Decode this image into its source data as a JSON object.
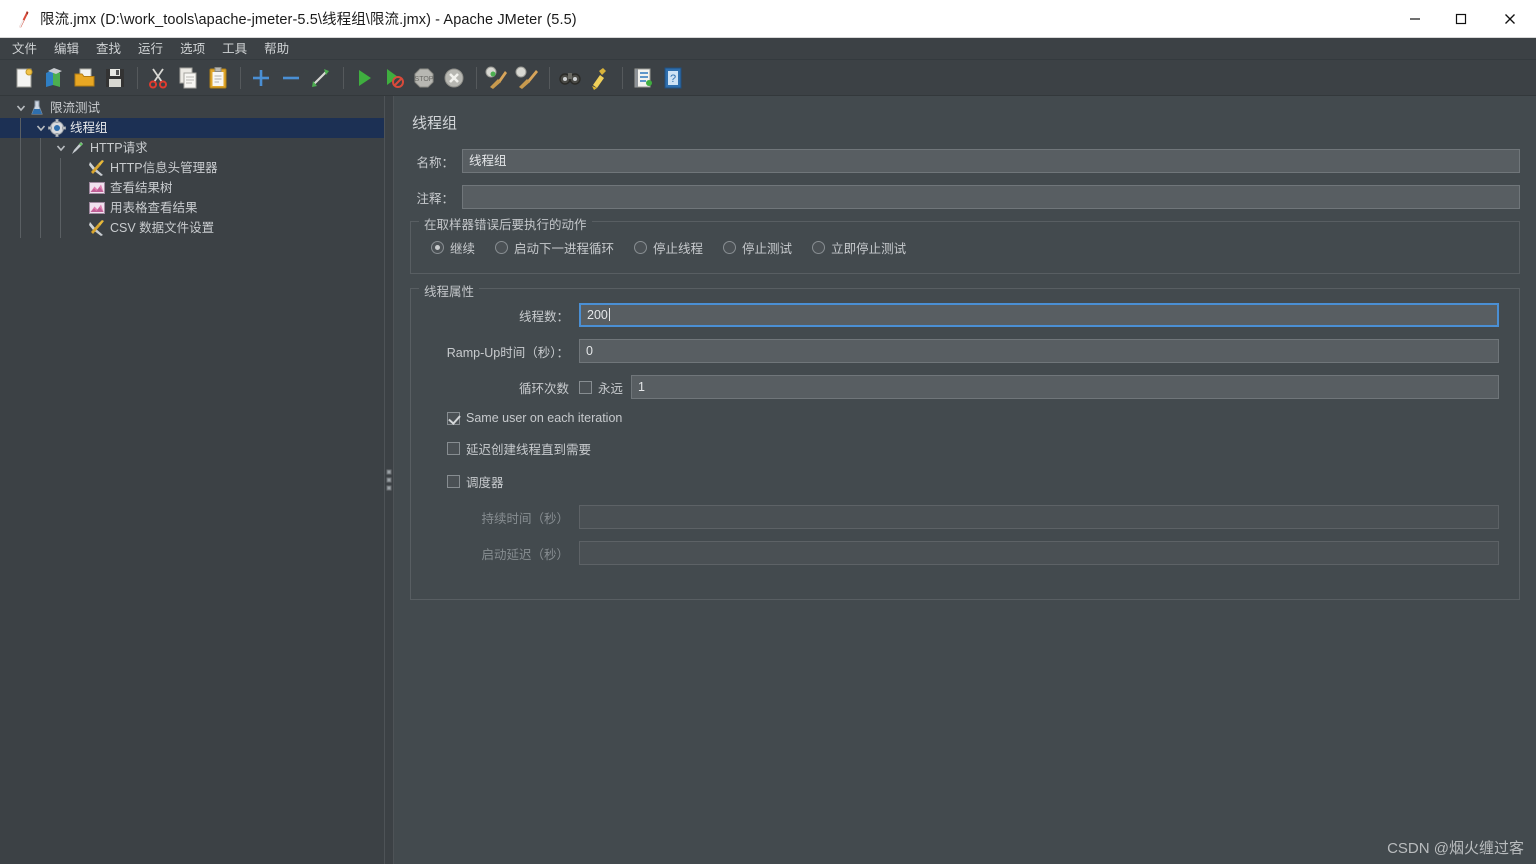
{
  "window": {
    "title": "限流.jmx (D:\\work_tools\\apache-jmeter-5.5\\线程组\\限流.jmx) - Apache JMeter (5.5)",
    "app_icon": "jmeter-feather-icon",
    "controls": {
      "minimize": "—",
      "maximize": "□",
      "close": "✕"
    }
  },
  "menubar": {
    "items": [
      {
        "label": "文件",
        "name": "menu-file"
      },
      {
        "label": "编辑",
        "name": "menu-edit"
      },
      {
        "label": "查找",
        "name": "menu-search"
      },
      {
        "label": "运行",
        "name": "menu-run"
      },
      {
        "label": "选项",
        "name": "menu-options"
      },
      {
        "label": "工具",
        "name": "menu-tools"
      },
      {
        "label": "帮助",
        "name": "menu-help"
      }
    ]
  },
  "toolbar": {
    "items": [
      "new-icon",
      "templates-icon",
      "open-icon",
      "save-icon",
      "cut-icon",
      "copy-icon",
      "paste-icon",
      "expand-all-icon",
      "collapse-all-icon",
      "toggle-icon",
      "start-icon",
      "start-no-pauses-icon",
      "stop-icon",
      "shutdown-icon",
      "clear-icon",
      "clear-all-icon",
      "search-icon",
      "search-reset-icon",
      "function-helper-icon",
      "help-icon"
    ]
  },
  "tree": {
    "items": [
      {
        "label": "限流测试",
        "icon": "test-plan-icon",
        "depth": 0,
        "expanded": true,
        "selected": false,
        "name": "tree-item-test-plan"
      },
      {
        "label": "线程组",
        "icon": "thread-group-icon",
        "depth": 1,
        "expanded": true,
        "selected": true,
        "name": "tree-item-thread-group"
      },
      {
        "label": "HTTP请求",
        "icon": "http-request-icon",
        "depth": 2,
        "expanded": true,
        "selected": false,
        "name": "tree-item-http-request"
      },
      {
        "label": "HTTP信息头管理器",
        "icon": "header-manager-icon",
        "depth": 3,
        "expanded": false,
        "selected": false,
        "name": "tree-item-header-manager"
      },
      {
        "label": "查看结果树",
        "icon": "view-results-tree-icon",
        "depth": 3,
        "expanded": false,
        "selected": false,
        "name": "tree-item-view-results-tree"
      },
      {
        "label": "用表格查看结果",
        "icon": "view-results-table-icon",
        "depth": 3,
        "expanded": false,
        "selected": false,
        "name": "tree-item-view-results-table"
      },
      {
        "label": "CSV 数据文件设置",
        "icon": "csv-data-set-icon",
        "depth": 3,
        "expanded": false,
        "selected": false,
        "name": "tree-item-csv-data-set"
      }
    ]
  },
  "panel": {
    "title": "线程组",
    "name": {
      "label": "名称：",
      "value": "线程组"
    },
    "comments": {
      "label": "注释：",
      "value": ""
    },
    "error_action": {
      "title": "在取样器错误后要执行的动作",
      "options": [
        {
          "label": "继续",
          "selected": true,
          "name": "radio-continue"
        },
        {
          "label": "启动下一进程循环",
          "selected": false,
          "name": "radio-start-next-loop"
        },
        {
          "label": "停止线程",
          "selected": false,
          "name": "radio-stop-thread"
        },
        {
          "label": "停止测试",
          "selected": false,
          "name": "radio-stop-test"
        },
        {
          "label": "立即停止测试",
          "selected": false,
          "name": "radio-stop-test-now"
        }
      ]
    },
    "thread_properties": {
      "title": "线程属性",
      "num_threads": {
        "label": "线程数：",
        "value": "200",
        "focused": true
      },
      "ramp_up": {
        "label": "Ramp-Up时间（秒）：",
        "value": "0",
        "focused": false
      },
      "loop_count": {
        "label": "循环次数",
        "forever_label": "永远",
        "forever_checked": false,
        "value": "1"
      },
      "same_user": {
        "label": "Same user on each iteration",
        "checked": true
      },
      "delayed_start": {
        "label": "延迟创建线程直到需要",
        "checked": false
      },
      "scheduler": {
        "label": "调度器",
        "checked": false
      },
      "duration": {
        "label": "持续时间（秒）",
        "value": "",
        "enabled": false
      },
      "startup_delay": {
        "label": "启动延迟（秒）",
        "value": "",
        "enabled": false
      }
    }
  },
  "watermark": {
    "text": "CSDN @烟火缠过客"
  },
  "colors": {
    "titlebar_bg": "#ffffff",
    "chrome_bg": "#3c4145",
    "panel_bg": "#434a4e",
    "selection_bg": "#1c3054",
    "focus_border": "#4a8fd4",
    "text": "#c8cbce"
  }
}
